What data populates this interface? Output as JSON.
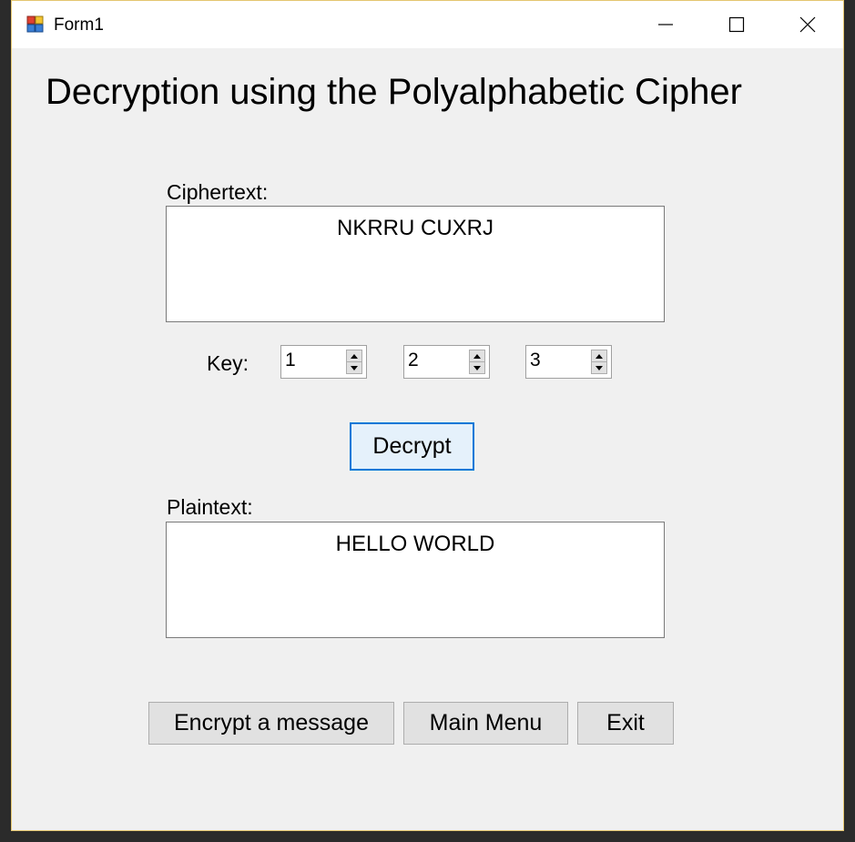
{
  "window": {
    "title": "Form1",
    "icon": "winforms-app-icon",
    "controls": [
      "minimize-icon",
      "maximize-icon",
      "close-icon"
    ]
  },
  "heading": "Decryption using the Polyalphabetic Cipher",
  "ciphertext": {
    "label": "Ciphertext:",
    "value": "NKRRU CUXRJ"
  },
  "key": {
    "label": "Key:",
    "values": [
      "1",
      "2",
      "3"
    ]
  },
  "decrypt_button": "Decrypt",
  "plaintext": {
    "label": "Plaintext:",
    "value": "HELLO WORLD"
  },
  "footer_buttons": {
    "encrypt": "Encrypt a message",
    "main_menu": "Main Menu",
    "exit": "Exit"
  },
  "colors": {
    "form_background": "#f0f0f0",
    "titlebar_background": "#ffffff",
    "focus_border": "#0078d7",
    "button_background": "#e1e1e1"
  }
}
